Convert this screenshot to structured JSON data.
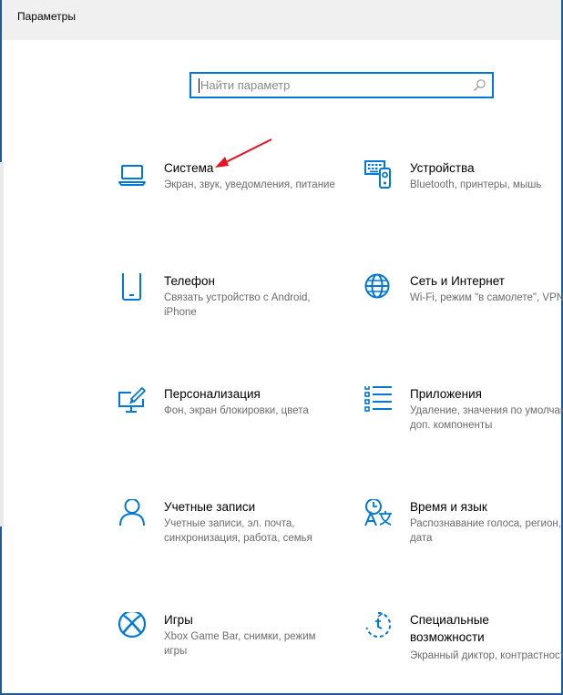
{
  "window": {
    "title": "Параметры"
  },
  "search": {
    "placeholder": "Найти параметр"
  },
  "accent": "#0078d7",
  "annotation_color": "#e81123",
  "tiles": [
    {
      "title": "Система",
      "desc": "Экран, звук, уведомления, питание",
      "icon": "laptop-icon"
    },
    {
      "title": "Устройства",
      "desc": "Bluetooth, принтеры, мышь",
      "icon": "keyboard-printer-icon"
    },
    {
      "title": "Телефон",
      "desc": "Связать устройство с Android, iPhone",
      "icon": "phone-icon"
    },
    {
      "title": "Сеть и Интернет",
      "desc": "Wi-Fi, режим \"в самолете\", VPN",
      "icon": "globe-icon"
    },
    {
      "title": "Персонализация",
      "desc": "Фон, экран блокировки, цвета",
      "icon": "paint-brush-icon"
    },
    {
      "title": "Приложения",
      "desc": "Удаление, значения по умолчанию, доп. компоненты",
      "icon": "apps-list-icon"
    },
    {
      "title": "Учетные записи",
      "desc": "Учетные записи, эл. почта, синхронизация, работа, семья",
      "icon": "person-icon"
    },
    {
      "title": "Время и язык",
      "desc": "Распознавание голоса, регион, дата",
      "icon": "time-language-icon"
    },
    {
      "title": "Игры",
      "desc": "Xbox Game Bar, снимки, режим игры",
      "icon": "xbox-icon"
    },
    {
      "title_line1": "Специальные",
      "title_line2": "возможности",
      "desc": "Экранный диктор, контрастность",
      "icon": "accessibility-icon"
    }
  ]
}
